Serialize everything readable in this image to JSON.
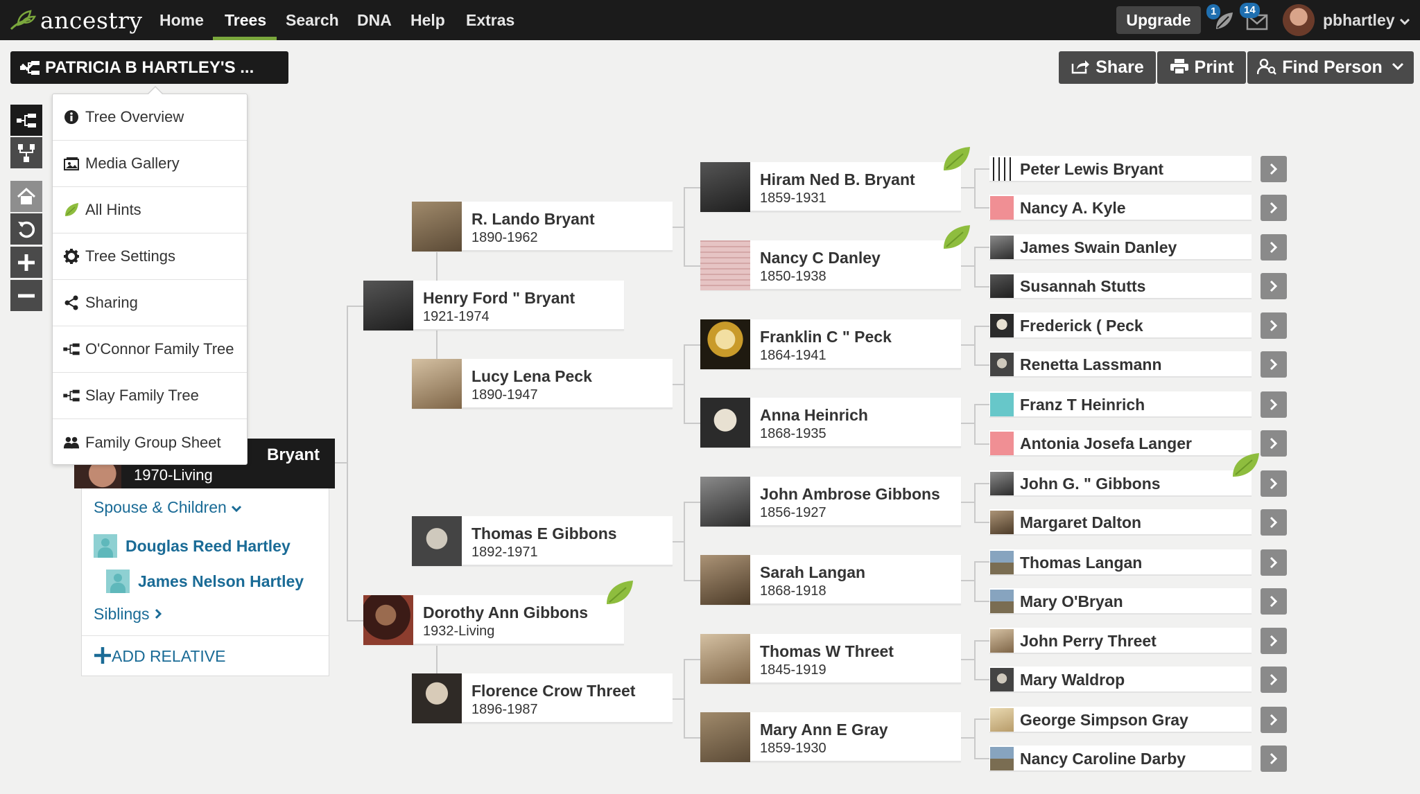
{
  "brand": {
    "name": "ancestry"
  },
  "nav": {
    "items": [
      "Home",
      "Trees",
      "Search",
      "DNA",
      "Help",
      "Extras"
    ],
    "active": "Trees",
    "upgrade": "Upgrade",
    "hint_count": "1",
    "message_count": "14",
    "username": "pbhartley"
  },
  "tree_header": {
    "title": "PATRICIA B HARTLEY'S ...",
    "share": "Share",
    "print": "Print",
    "find_person": "Find Person"
  },
  "left_toolbar": [
    "pedigree-view",
    "family-view",
    "home",
    "reset",
    "zoom-in",
    "zoom-out"
  ],
  "tree_menu": {
    "items": [
      {
        "label": "Tree Overview",
        "icon": "info-icon"
      },
      {
        "label": "Media Gallery",
        "icon": "media-icon"
      },
      {
        "label": "All Hints",
        "icon": "leaf-icon"
      },
      {
        "label": "Tree Settings",
        "icon": "gear-icon"
      },
      {
        "label": "Sharing",
        "icon": "share-icon"
      },
      {
        "label": "O'Connor Family Tree",
        "icon": "tree-icon"
      },
      {
        "label": "Slay Family Tree",
        "icon": "tree-icon"
      },
      {
        "label": "Family Group Sheet",
        "icon": "group-icon"
      }
    ]
  },
  "home_person": {
    "name_visible": "Bryant",
    "years": "1970-Living",
    "spouse_children_label": "Spouse & Children",
    "spouse": "Douglas Reed Hartley",
    "child": "James Nelson Hartley",
    "siblings_label": "Siblings",
    "add_relative": "ADD RELATIVE"
  },
  "parents": [
    {
      "name": "Henry Ford \" Bryant",
      "years": "1921-1974"
    },
    {
      "name": "Dorothy Ann Gibbons",
      "years": "1932-Living"
    }
  ],
  "grandparents": [
    {
      "name": "R. Lando Bryant",
      "years": "1890-1962"
    },
    {
      "name": "Lucy Lena Peck",
      "years": "1890-1947"
    },
    {
      "name": "Thomas E Gibbons",
      "years": "1892-1971"
    },
    {
      "name": "Florence Crow Threet",
      "years": "1896-1987"
    }
  ],
  "great_grandparents": [
    {
      "name": "Hiram Ned B. Bryant",
      "years": "1859-1931"
    },
    {
      "name": "Nancy C Danley",
      "years": "1850-1938"
    },
    {
      "name": "Franklin C \" Peck",
      "years": "1864-1941"
    },
    {
      "name": "Anna Heinrich",
      "years": "1868-1935"
    },
    {
      "name": "John Ambrose Gibbons",
      "years": "1856-1927"
    },
    {
      "name": "Sarah Langan",
      "years": "1868-1918"
    },
    {
      "name": "Thomas W Threet",
      "years": "1845-1919"
    },
    {
      "name": "Mary Ann E Gray",
      "years": "1859-1930"
    }
  ],
  "great_great_grandparents": [
    "Peter Lewis Bryant",
    "Nancy A. Kyle",
    "James Swain Danley",
    "Susannah Stutts",
    "Frederick ( Peck",
    "Renetta Lassmann",
    "Franz T Heinrich",
    "Antonia Josefa Langer",
    "John G. \" Gibbons",
    "Margaret Dalton",
    "Thomas Langan",
    "Mary O'Bryan",
    "John Perry Threet",
    "Mary Waldrop",
    "George Simpson Gray",
    "Nancy Caroline Darby"
  ],
  "colors": {
    "nav_bg": "#1b1b1b",
    "accent_green": "#7aa73c",
    "link_blue": "#1a6b96",
    "page_bg": "#f1f1f0"
  }
}
